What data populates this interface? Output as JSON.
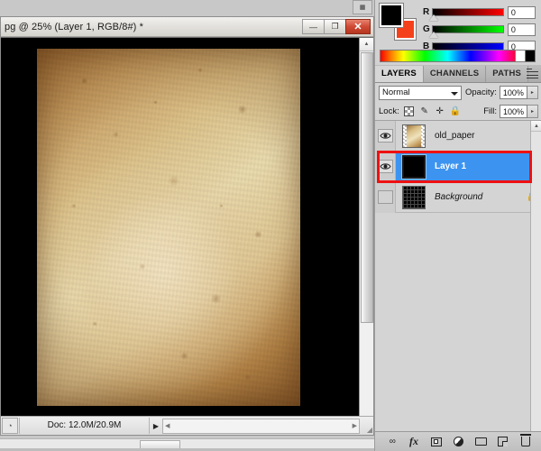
{
  "document_window": {
    "title": "pg @ 25% (Layer 1, RGB/8#) *",
    "window_buttons": {
      "minimize": "—",
      "restore": "❐",
      "close": "✕"
    },
    "status": {
      "doc_label": "Doc: 12.0M/20.9M",
      "expand_arrow": "▶",
      "left_icon": "clock-icon",
      "scroll_left_arrow": "◀",
      "scroll_right_arrow": "▶"
    },
    "canvas": {
      "image_name": "old-paper-texture",
      "background": "#000000",
      "scroll_up_arrow": "▲",
      "scroll_down_arrow": "▼"
    }
  },
  "color_panel": {
    "foreground_color": "#000000",
    "background_color": "#f4411c",
    "channels": [
      {
        "label": "R",
        "value": "0"
      },
      {
        "label": "G",
        "value": "0"
      },
      {
        "label": "B",
        "value": "0"
      }
    ],
    "spectrum_white": "#ffffff",
    "spectrum_black": "#000000"
  },
  "layers_panel": {
    "tabs": [
      {
        "label": "LAYERS",
        "active": true
      },
      {
        "label": "CHANNELS",
        "active": false
      },
      {
        "label": "PATHS",
        "active": false
      }
    ],
    "menu_icon": "panel-menu-icon",
    "blend_mode": "Normal",
    "opacity_label": "Opacity:",
    "opacity_value": "100%",
    "lock_label": "Lock:",
    "lock_icons": [
      "lock-transparent-pixels-icon",
      "lock-image-pixels-icon",
      "lock-position-icon",
      "lock-all-icon"
    ],
    "fill_label": "Fill:",
    "fill_value": "100%",
    "stepper_arrow": "▸",
    "layers": [
      {
        "name": "old_paper",
        "visible": true,
        "selected": false,
        "locked": false,
        "thumbnail": "paper-texture-thumbnail",
        "eye_icon": "eye-icon"
      },
      {
        "name": "Layer 1",
        "visible": true,
        "selected": true,
        "locked": false,
        "thumbnail": "black-fill-thumbnail",
        "eye_icon": "eye-icon"
      },
      {
        "name": "Background",
        "visible": false,
        "selected": false,
        "locked": true,
        "thumbnail": "grid-pattern-thumbnail",
        "eye_icon": "eye-icon",
        "lock_badge": "padlock-icon"
      }
    ],
    "bottom_toolbar": [
      {
        "icon": "link-layers-icon",
        "glyph": "∞"
      },
      {
        "icon": "layer-style-fx-icon",
        "glyph": "fx"
      },
      {
        "icon": "add-layer-mask-icon",
        "glyph": ""
      },
      {
        "icon": "new-adjustment-layer-icon",
        "glyph": ""
      },
      {
        "icon": "new-group-icon",
        "glyph": ""
      },
      {
        "icon": "new-layer-icon",
        "glyph": ""
      },
      {
        "icon": "delete-layer-icon",
        "glyph": ""
      }
    ],
    "scroll_up_arrow": "▲",
    "scroll_down_arrow": "▼"
  },
  "annotation": {
    "highlight_color": "#ee1111",
    "target": "Layer 1"
  },
  "toolbar_remnant": {
    "icon": "tool-preset-icon",
    "glyph": "▦"
  }
}
